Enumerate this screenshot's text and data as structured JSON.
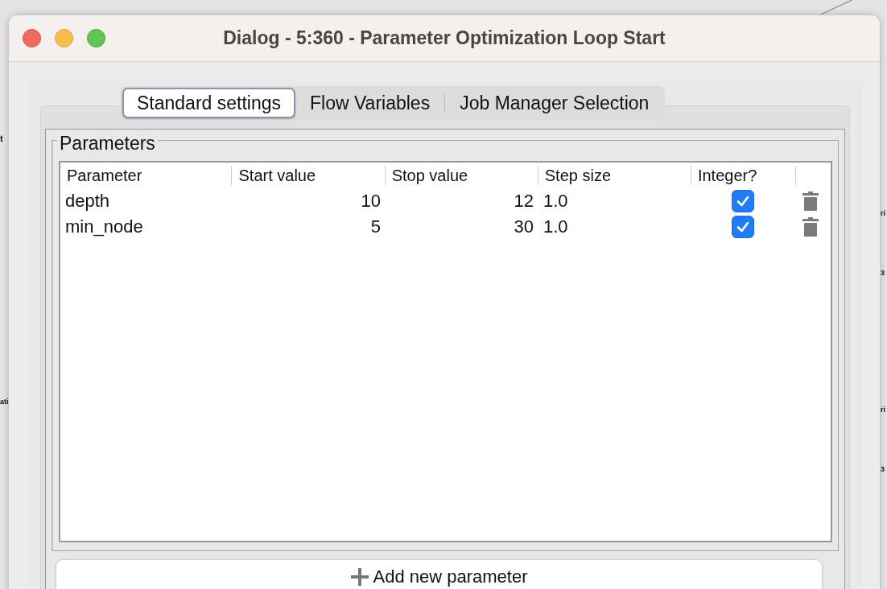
{
  "canvas_left_labels": [
    "t",
    "ati"
  ],
  "canvas_right_labels": [
    "ri",
    "3",
    "ri",
    "3"
  ],
  "window": {
    "title": "Dialog - 5:360 - Parameter Optimization Loop Start"
  },
  "tabs": [
    {
      "label": "Standard settings",
      "selected": true
    },
    {
      "label": "Flow Variables",
      "selected": false
    },
    {
      "label": "Job Manager Selection",
      "selected": false
    }
  ],
  "parameters": {
    "title": "Parameters",
    "table": {
      "columns": [
        "Parameter",
        "Start value",
        "Stop value",
        "Step size",
        "Integer?"
      ],
      "rows": [
        {
          "parameter": "depth",
          "start": "10",
          "stop": "12",
          "step": "1.0",
          "integer": true
        },
        {
          "parameter": "min_node",
          "start": "5",
          "stop": "30",
          "step": "1.0",
          "integer": true
        }
      ]
    }
  },
  "add_button": {
    "label": "Add new parameter"
  }
}
